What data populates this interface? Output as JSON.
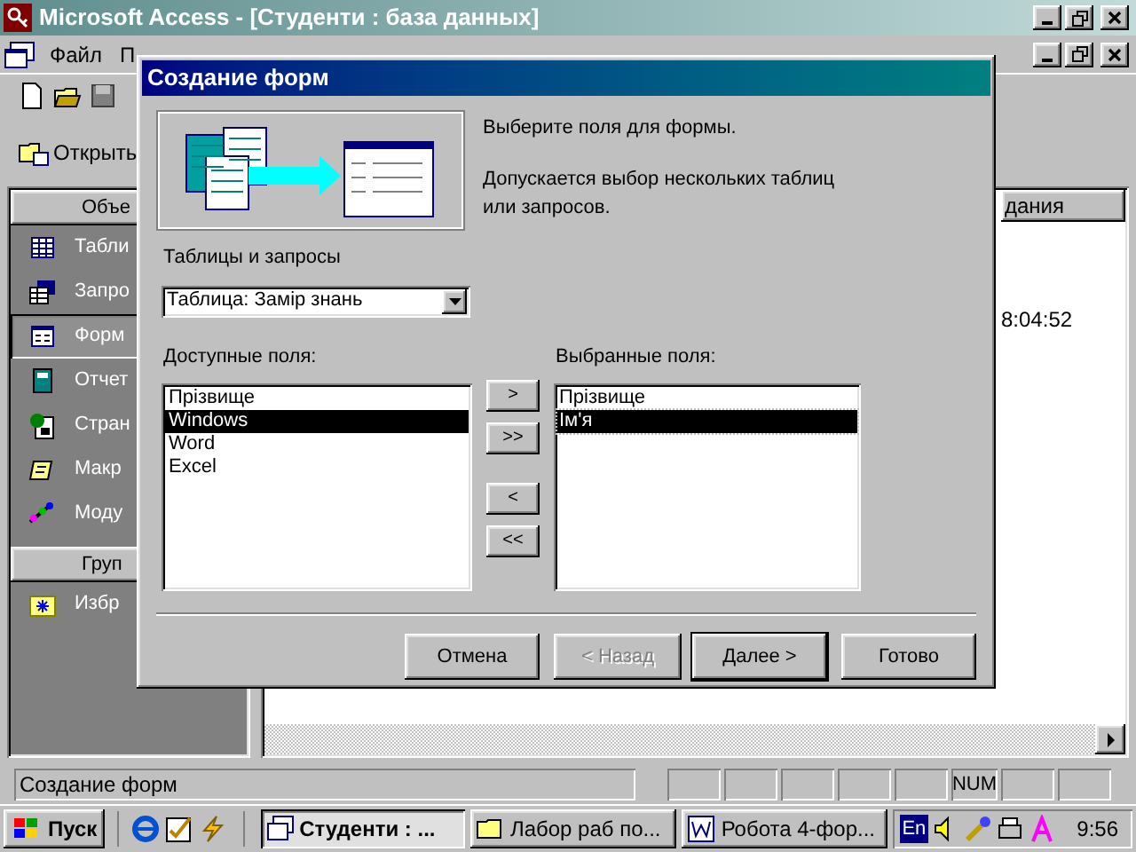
{
  "window": {
    "title": "Microsoft Access - [Студенти : база данных]"
  },
  "menu": [
    {
      "label": "Файл"
    },
    {
      "label": "П"
    }
  ],
  "database_window": {
    "open_button": "Открыть",
    "objects_header": "Объе",
    "objects": [
      {
        "label": "Табли",
        "selected": false
      },
      {
        "label": "Запро",
        "selected": false
      },
      {
        "label": "Форм",
        "selected": true
      },
      {
        "label": "Отчет",
        "selected": false
      },
      {
        "label": "Стран",
        "selected": false
      },
      {
        "label": "Макр",
        "selected": false
      },
      {
        "label": "Моду",
        "selected": false
      }
    ],
    "groups_header": "Груп",
    "groups": [
      {
        "label": "Избр"
      }
    ],
    "column_header": "дания",
    "cell": "8:04:52"
  },
  "dialog": {
    "title": "Создание форм",
    "intro": "Выберите поля для формы.",
    "hint": "Допускается выбор нескольких таблиц или запросов.",
    "source_label": "Таблицы и запросы",
    "source_value": "Таблица: Замір знань",
    "available_label": "Доступные поля:",
    "available": [
      {
        "label": "Прізвище",
        "selected": false
      },
      {
        "label": "Windows",
        "selected": true
      },
      {
        "label": "Word",
        "selected": false
      },
      {
        "label": "Excel",
        "selected": false
      }
    ],
    "chosen_label": "Выбранные поля:",
    "chosen": [
      {
        "label": "Прізвище",
        "selected": false
      },
      {
        "label": "Ім'я",
        "selected": true
      }
    ],
    "move_buttons": [
      ">",
      ">>",
      "<",
      "<<"
    ],
    "buttons": [
      {
        "label": "Отмена",
        "disabled": false,
        "default": false
      },
      {
        "label": "< Назад",
        "disabled": true,
        "default": false
      },
      {
        "label": "Далее >",
        "disabled": false,
        "default": true
      },
      {
        "label": "Готово",
        "disabled": false,
        "default": false
      }
    ]
  },
  "status_bar": {
    "text": "Создание форм",
    "indicators": [
      {
        "kind": "blank"
      },
      {
        "kind": "blank"
      },
      {
        "kind": "blank"
      },
      {
        "kind": "blank"
      },
      {
        "kind": "blank"
      },
      {
        "kind": "text",
        "label": "NUM"
      },
      {
        "kind": "blank"
      },
      {
        "kind": "blank"
      }
    ]
  },
  "taskbar": {
    "start": "Пуск",
    "tasks": [
      {
        "label": "Студенти : ...",
        "selected": true
      },
      {
        "label": "Лабор раб по...",
        "selected": false
      },
      {
        "label": "Робота 4-фор...",
        "selected": false
      }
    ],
    "language": "En",
    "clock": "9:56"
  }
}
